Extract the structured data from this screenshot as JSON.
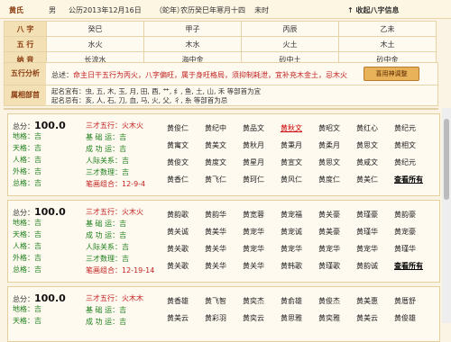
{
  "header": {
    "surname_label": "黄氏",
    "gender": "男",
    "solar": "公历2013年12月16日",
    "zodiac": "（蛇年）",
    "lunar": "农历癸巳年寒月十四",
    "hour": "未时",
    "collect": "↑ 收起八字信息"
  },
  "bazi": {
    "rows": [
      {
        "label": "八 字",
        "cells": [
          "癸巳",
          "甲子",
          "丙辰",
          "乙未"
        ]
      },
      {
        "label": "五 行",
        "cells": [
          "水火",
          "木水",
          "火土",
          "木土"
        ]
      },
      {
        "label": "纳 音",
        "cells": [
          "长流水",
          "海中金",
          "砂中土",
          "砂中金"
        ]
      }
    ]
  },
  "analysis": {
    "label": "五行分析",
    "prefix": "总述：",
    "text": "命主日干五行为丙火，八字偏旺，属于身旺格局，须抑制耗泄，宜补充木金土，忌木火",
    "button": "喜用神调整"
  },
  "bushou": {
    "label": "属相部首",
    "line1_prefix": "起名宜有：",
    "line1": "虫, 五, 木, 玉, 月, 田, 酉, 艹, 纟, 鱼, 土, 山, 禾  等部首为宜",
    "line2_prefix": "起名忌有：",
    "line2": "亥, 人, 石, 刀, 血, 马, 火, 父, 彳, 糸  等部首为忌"
  },
  "cards": [
    {
      "score_label": "总分：",
      "score": "100.0",
      "left": [
        "地格：吉",
        "天格：吉",
        "人格：吉",
        "外格：吉",
        "总格：吉"
      ],
      "mid": [
        {
          "t": "三才五行：火木火",
          "red": true
        },
        {
          "t": "基 础 运：吉",
          "red": false
        },
        {
          "t": "成 功 运：吉",
          "red": false
        },
        {
          "t": "人际关系：吉",
          "red": false
        },
        {
          "t": "三才数理：吉",
          "red": false
        },
        {
          "t": "笔画组合：12-9-4",
          "red": false
        }
      ],
      "names": [
        [
          "黄俊仁",
          "黄纪中",
          "黄品文",
          "黄秋文",
          "黄昭文",
          "黄红心",
          "黄纪元"
        ],
        [
          "黄寓文",
          "黄美文",
          "黄秋月",
          "黄秉月",
          "黄柔月",
          "黄思文",
          "黄相文"
        ],
        [
          "黄俊文",
          "黄度文",
          "黄星月",
          "黄宣文",
          "黄思文",
          "黄咸文",
          "黄纪元"
        ],
        [
          "黄香仁",
          "黄飞仁",
          "黄珂仁",
          "黄风仁",
          "黄度仁",
          "黄美仁",
          "查看所有"
        ]
      ]
    },
    {
      "score_label": "总分：",
      "score": "100.0",
      "left": [
        "地格：吉",
        "天格：吉",
        "人格：吉",
        "外格：吉",
        "总格：吉"
      ],
      "mid": [
        {
          "t": "三才五行：火木火",
          "red": true
        },
        {
          "t": "基 础 运：吉",
          "red": false
        },
        {
          "t": "成 功 运：吉",
          "red": false
        },
        {
          "t": "人际关系：吉",
          "red": false
        },
        {
          "t": "三才数理：吉",
          "red": false
        },
        {
          "t": "笔画组合：12-19-14",
          "red": false
        }
      ],
      "names": [
        [
          "黄韵歌",
          "黄韵华",
          "黄宽蓉",
          "黄宠福",
          "黄关豪",
          "黄瑾豪",
          "黄韵豪"
        ],
        [
          "黄关诚",
          "黄美华",
          "黄宠华",
          "黄宠诚",
          "黄美豪",
          "黄瑾华",
          "黄宠豪"
        ],
        [
          "黄关歌",
          "黄关华",
          "黄宠华",
          "黄宠华",
          "黄宠华",
          "黄宠华",
          "黄瑾华"
        ],
        [
          "黄关歌",
          "黄关华",
          "黄关华",
          "黄韩歌",
          "黄瑾歌",
          "黄韵诚",
          "查看所有"
        ]
      ]
    },
    {
      "score_label": "总分：",
      "score": "100.0",
      "left": [
        "地格：吉",
        "天格：吉"
      ],
      "mid": [
        {
          "t": "三才五行：火木木",
          "red": true
        },
        {
          "t": "基 础 运：吉",
          "red": false
        },
        {
          "t": "成 功 运：吉",
          "red": false
        }
      ],
      "names": [
        [
          "黄香雄",
          "黄飞智",
          "黄奕杰",
          "黄俞雄",
          "黄俊杰",
          "黄美惠",
          "黄厝舒"
        ],
        [
          "黄美云",
          "黄彩羽",
          "黄奕云",
          "黄思雅",
          "黄奕雅",
          "黄美云",
          "黄俊雄"
        ]
      ]
    }
  ]
}
